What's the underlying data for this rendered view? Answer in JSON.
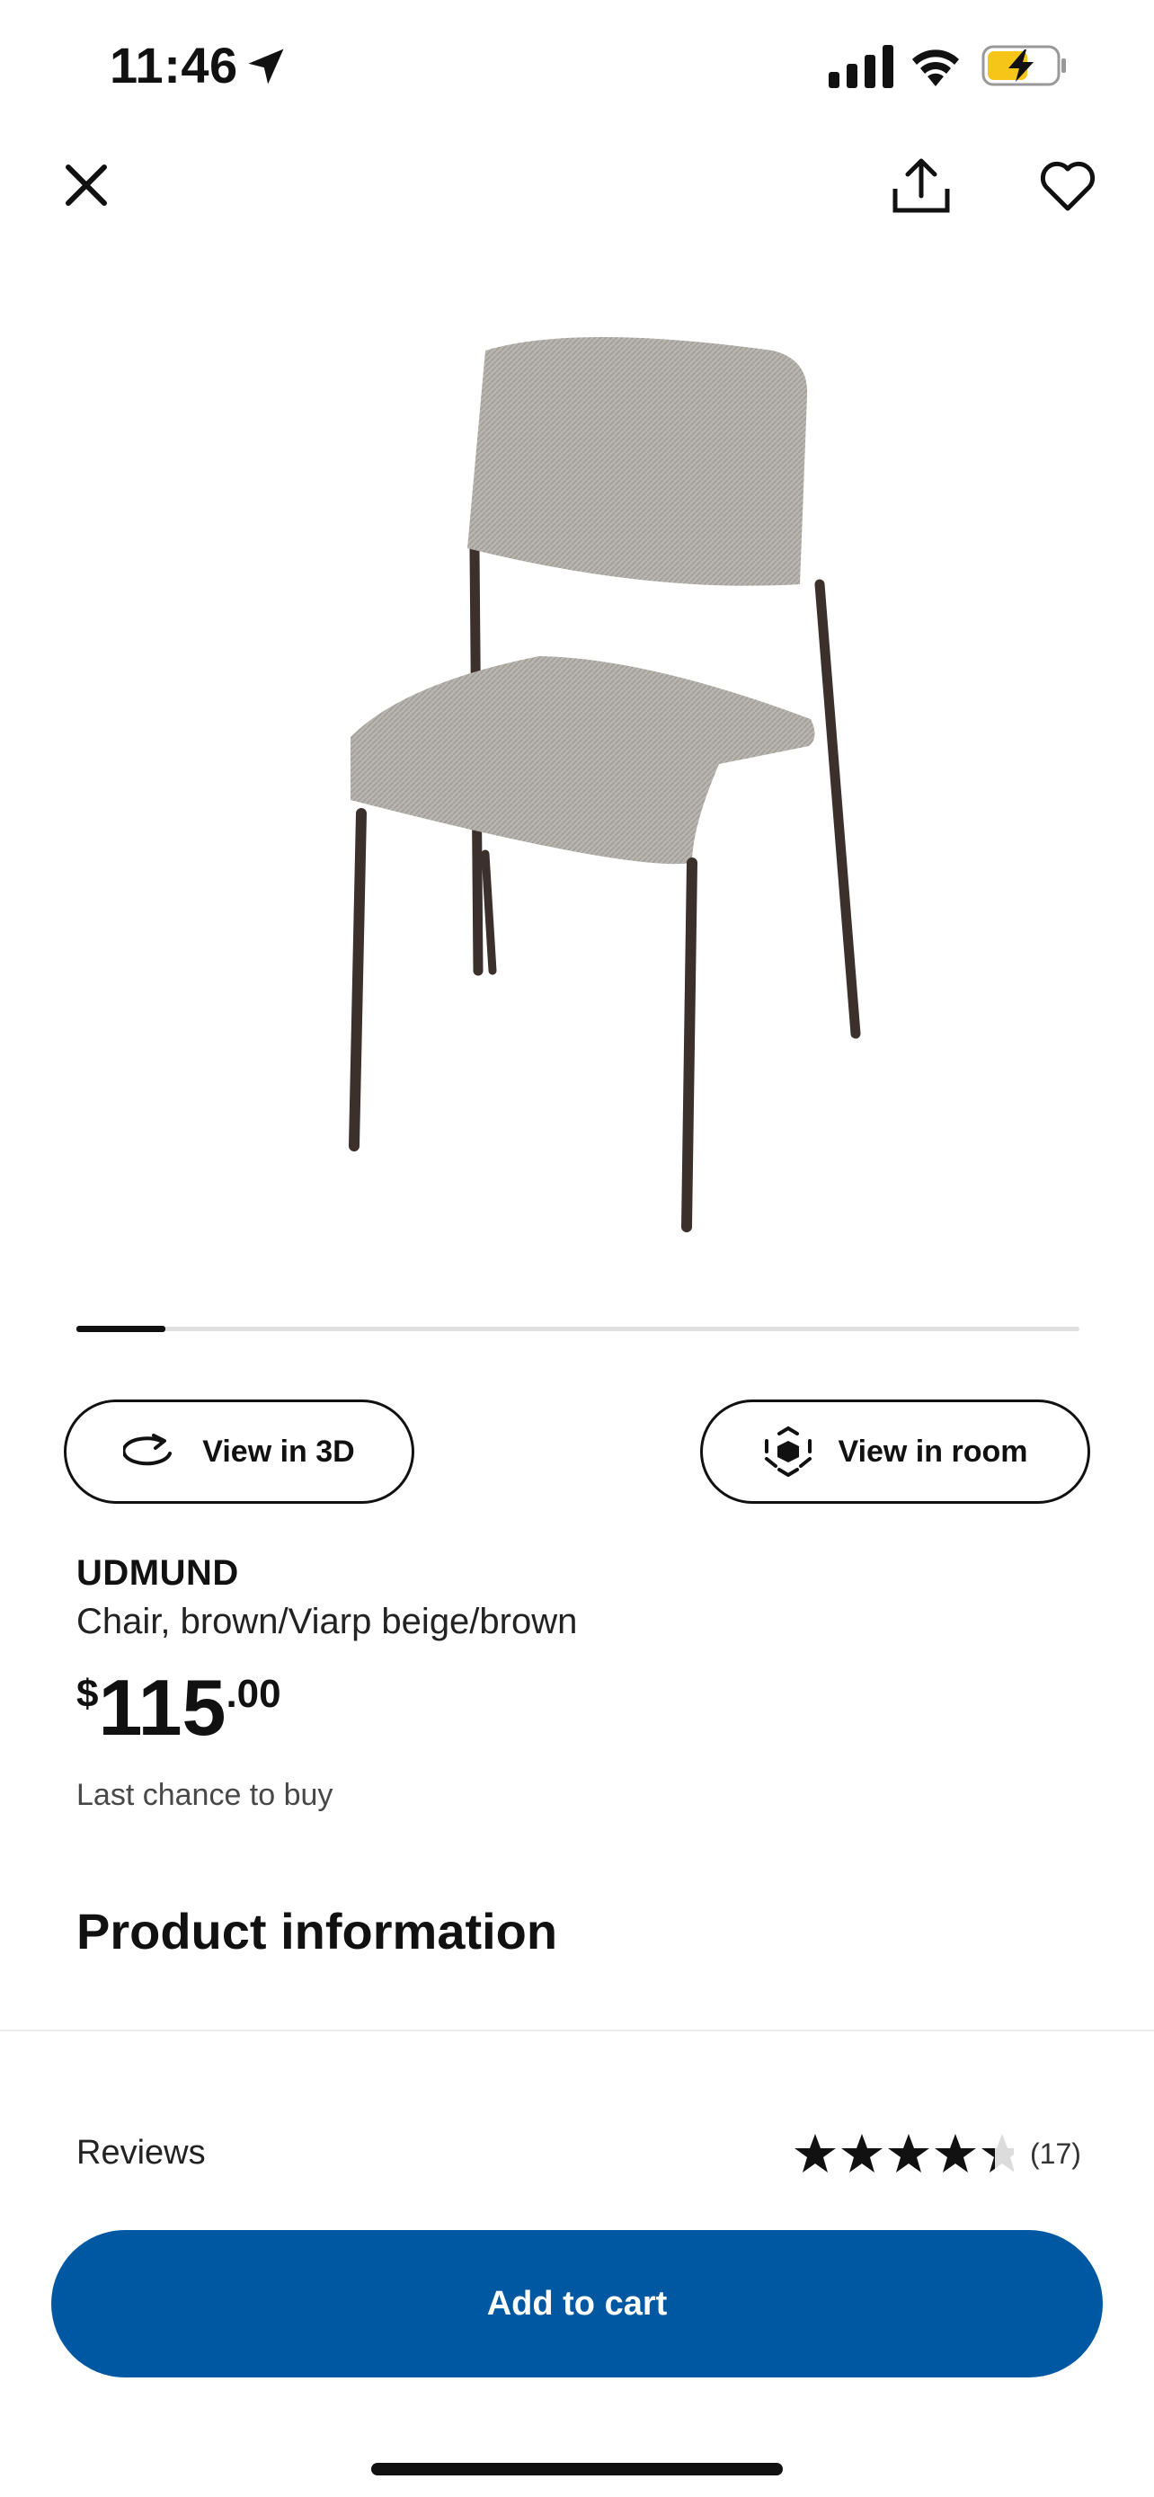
{
  "status_bar": {
    "time": "11:46"
  },
  "product": {
    "name": "UDMUND",
    "description": "Chair, brown/Viarp beige/brown",
    "price": {
      "currency": "$",
      "integer": "115",
      "decimal": ".00"
    },
    "stock_note": "Last chance to buy"
  },
  "carousel": {
    "current": 1,
    "progress": 0.09
  },
  "actions": {
    "view_3d_label": "View in 3D",
    "view_room_label": "View in room"
  },
  "sections": {
    "product_info_title": "Product information"
  },
  "reviews": {
    "label": "Reviews",
    "rating": 4.7,
    "count_text": "(17)"
  },
  "cart": {
    "button_label": "Add to cart"
  },
  "colors": {
    "brand_blue": "#0058a3",
    "text": "#111111",
    "battery_charge": "#f5c518"
  },
  "icons": [
    "location-arrow-icon",
    "signal-icon",
    "wifi-icon",
    "battery-icon",
    "close-icon",
    "share-icon",
    "heart-icon",
    "rotate-3d-icon",
    "view-in-room-icon",
    "star-icon"
  ]
}
